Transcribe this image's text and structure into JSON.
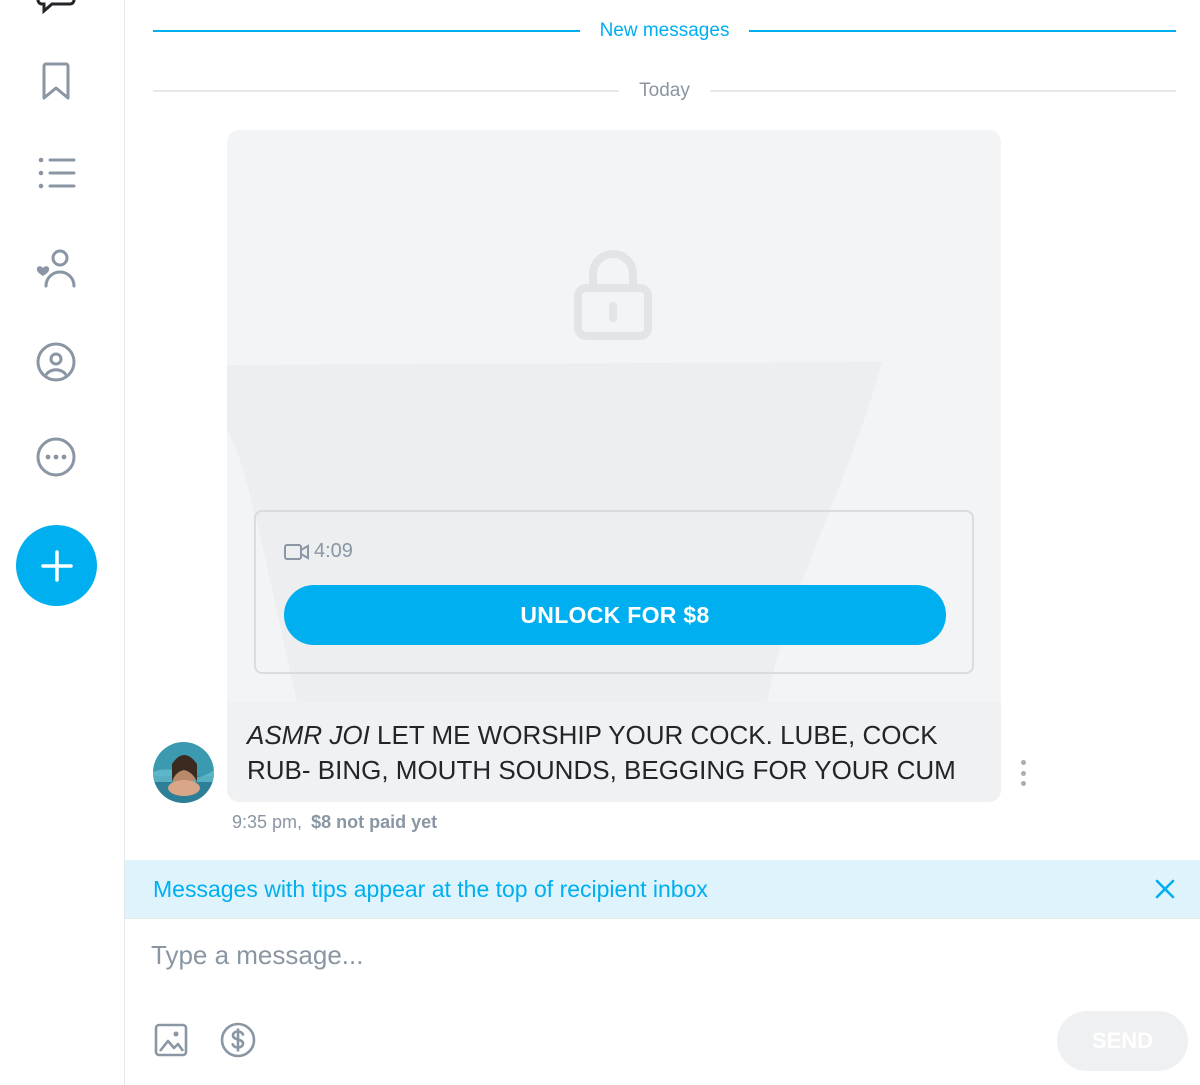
{
  "colors": {
    "accent": "#00aff0",
    "muted": "#8a96a3",
    "icon_gray": "#8a96a3",
    "banner_bg": "#dff3fc"
  },
  "sidebar": {
    "items": [
      {
        "icon": "chat-icon"
      },
      {
        "icon": "bookmark-icon"
      },
      {
        "icon": "starred-list-icon"
      },
      {
        "icon": "subscriptions-icon"
      },
      {
        "icon": "profile-icon"
      },
      {
        "icon": "more-icon"
      }
    ],
    "fab_icon": "plus-icon"
  },
  "chat": {
    "new_messages_label": "New messages",
    "date_label": "Today",
    "message": {
      "media": {
        "lock_icon": "lock-icon",
        "video_icon": "video-icon",
        "duration": "4:09",
        "unlock_label": "UNLOCK FOR $8"
      },
      "text_italic": "ASMR JOI",
      "text_rest": " LET ME WORSHIP YOUR COCK. LUBE, COCK RUB- BING, MOUTH SOUNDS, BEGGING FOR YOUR CUM",
      "time": "9:35 pm,",
      "payment_status": "$8 not paid yet"
    }
  },
  "tip_banner": {
    "text": "Messages with tips appear at the top of recipient inbox",
    "close_icon": "close-icon"
  },
  "composer": {
    "placeholder": "Type a message...",
    "value": "",
    "image_icon": "image-icon",
    "tip_icon": "dollar-icon",
    "send_label": "SEND"
  }
}
